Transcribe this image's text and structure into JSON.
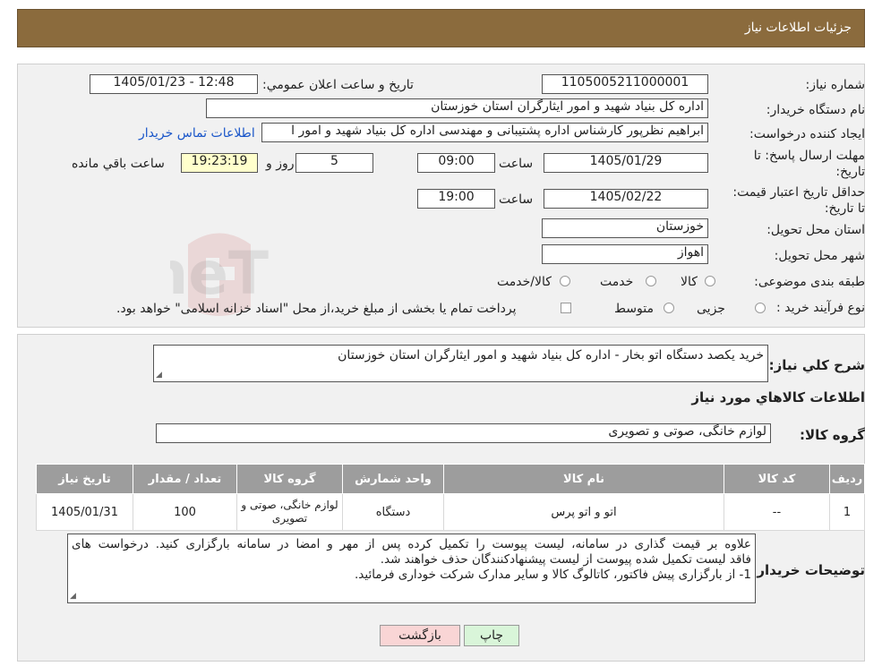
{
  "header": {
    "title": "جزئیات اطلاعات نیاز"
  },
  "fields": {
    "need_number_label": "شماره نیاز:",
    "need_number": "1105005211000001",
    "announce_label": "تاریخ و ساعت اعلان عمومي:",
    "announce_value": "1405/01/23 - 12:48",
    "buyer_label": "نام دستگاه خریدار:",
    "buyer_value": "اداره کل بنیاد شهید و امور ایثارگران استان خوزستان",
    "creator_label": "ایجاد کننده درخواست:",
    "creator_value": "ابراهیم نظرپور کارشناس اداره پشتیبانی و مهندسی اداره کل بنیاد شهید و امور ا",
    "contact_link": "اطلاعات تماس خریدار",
    "deadline_label": "مهلت ارسال پاسخ: تا تاریخ:",
    "deadline_date": "1405/01/29",
    "time_label": "ساعت",
    "deadline_time": "09:00",
    "days_value": "5",
    "days_label": "روز و",
    "remaining_time": "19:23:19",
    "remaining_label": "ساعت باقي مانده",
    "validity_label": "حداقل تاریخ اعتبار قیمت: تا تاریخ:",
    "validity_date": "1405/02/22",
    "validity_time": "19:00",
    "province_label": "استان محل تحویل:",
    "province_value": "خوزستان",
    "city_label": "شهر محل تحویل:",
    "city_value": "اهواز",
    "category_label": "طبقه بندی موضوعی:",
    "category_options": [
      "کالا",
      "خدمت",
      "کالا/خدمت"
    ],
    "process_label": "نوع فرآیند خرید :",
    "process_options": [
      "جزیی",
      "متوسط"
    ],
    "process_note": "پرداخت تمام یا بخشی از مبلغ خرید،از محل \"اسناد خزانه اسلامی\" خواهد بود."
  },
  "summary": {
    "label": "شرح کلي نیاز:",
    "value": "خرید یکصد دستگاه اتو بخار - اداره کل بنیاد شهید و امور ایثارگران استان خوزستان",
    "goods_title": "اطلاعات کالاهاي مورد نیاز",
    "group_label": "گروه کالا:",
    "group_value": "لوازم خانگی، صوتی و تصویری"
  },
  "table": {
    "headers": [
      "ردیف",
      "کد کالا",
      "نام کالا",
      "واحد شمارش",
      "گروه کالا",
      "تعداد / مقدار",
      "تاریخ نیاز"
    ],
    "rows": [
      [
        "1",
        "--",
        "اتو و اتو پرس",
        "دستگاه",
        "لوازم خانگی، صوتی و تصویری",
        "100",
        "1405/01/31"
      ]
    ]
  },
  "notes": {
    "label": "توضیحات خریدار:",
    "line1": "علاوه بر قیمت گذاری در سامانه، لیست پیوست را تکمیل کرده پس از مهر و امضا در سامانه بارگزاری کنید. درخواست های",
    "line2": "فاقد لیست تکمیل شده پیوست از لیست پیشنهادکنندگان حذف خواهند شد.",
    "line3": "1- از بارگزاری پیش فاکتور، کاتالوگ کالا و سایر مدارک شرکت خوداری فرمائید."
  },
  "buttons": {
    "print": "چاپ",
    "back": "بازگشت"
  },
  "watermark": {
    "text": "AriaTender.neT"
  },
  "colors": {
    "header_bg": "#8b6b3d",
    "panel_bg": "#f1f1f1",
    "table_header": "#9d9d9d",
    "remaining_bg": "#ffffcc",
    "back_btn": "#f9d5d5",
    "print_btn": "#d9f5d9"
  }
}
